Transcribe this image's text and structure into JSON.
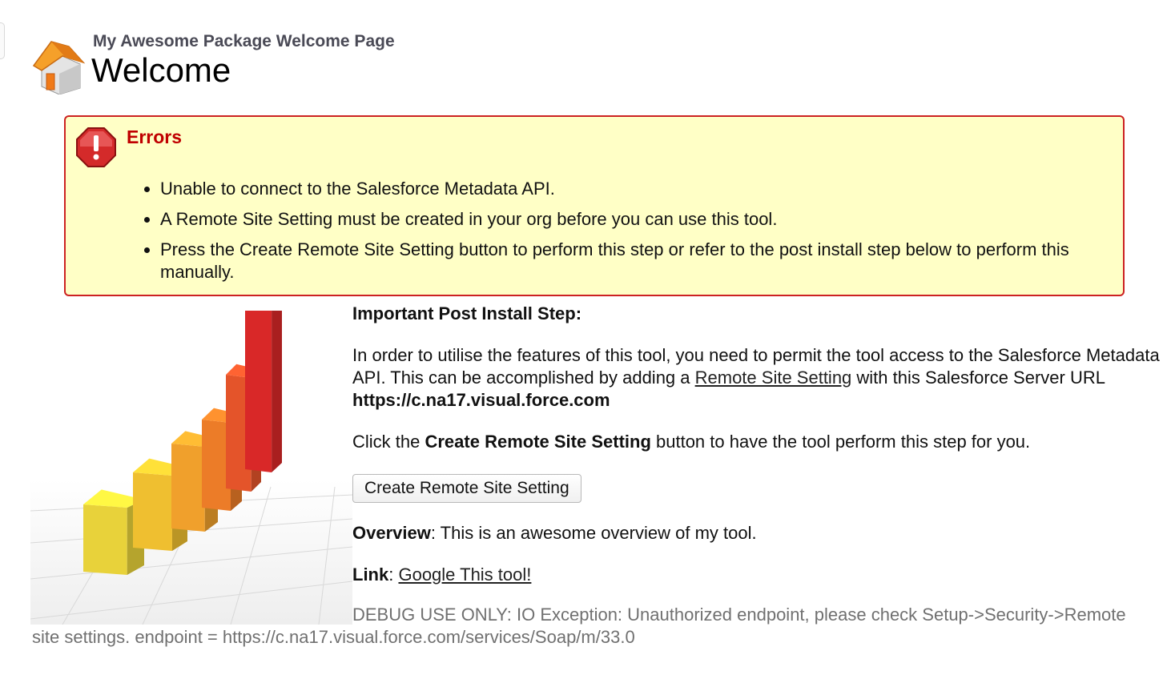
{
  "header": {
    "subtitle": "My Awesome Package Welcome Page",
    "title": "Welcome",
    "icon": "home-icon"
  },
  "errors": {
    "heading": "Errors",
    "icon": "error-icon",
    "accent_color": "#cc2222",
    "background": "#ffffc6",
    "items": [
      "Unable to connect to the Salesforce Metadata API.",
      "A Remote Site Setting must be created in your org before you can use this tool.",
      "Press the Create Remote Site Setting button to perform this step or refer to the post install step below to perform this manually."
    ]
  },
  "post_install": {
    "heading": "Important Post Install Step:",
    "para1_text1": "In order to utilise the features of this tool, you need to permit the tool access to the Salesforce Metadata API. This can be accomplished by adding a ",
    "remote_site_link": "Remote Site Setting",
    "para1_text2": " with this Salesforce Server URL ",
    "server_url": "https://c.na17.visual.force.com",
    "para2_text1": "Click the ",
    "para2_bold": "Create Remote Site Setting",
    "para2_text2": " button to have the tool perform this step for you.",
    "button_label": "Create Remote Site Setting"
  },
  "overview": {
    "label": "Overview",
    "text": ": This is an awesome overview of my tool."
  },
  "link": {
    "label": "Link",
    "separator": ": ",
    "text": "Google This tool!"
  },
  "debug": {
    "text": "DEBUG USE ONLY: IO Exception: Unauthorized endpoint, please check Setup->Security->Remote site settings. endpoint = https://c.na17.visual.force.com/services/Soap/m/33.0"
  },
  "illustration": {
    "name": "bar-chart-illustration",
    "bar_colors": [
      "#e8d23a",
      "#efbf30",
      "#f0a02c",
      "#ec7c28",
      "#e4542a",
      "#d92828"
    ]
  }
}
